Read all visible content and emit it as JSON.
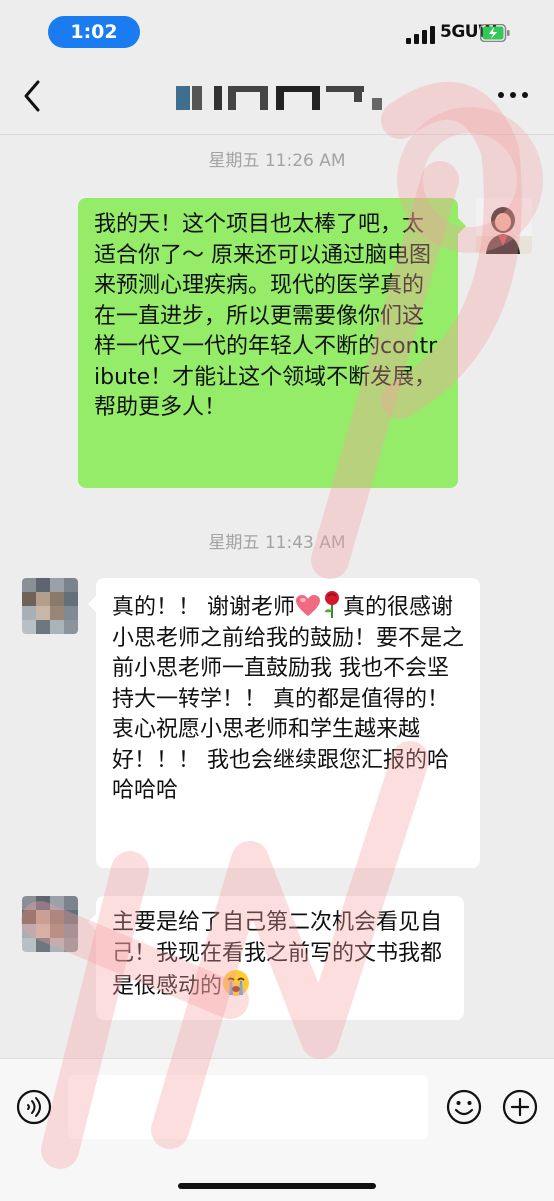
{
  "status_bar": {
    "time": "1:02",
    "network": "5GUW"
  },
  "nav": {
    "back_icon": "chevron-left-icon",
    "title": "",
    "more_icon": "more-dots-icon"
  },
  "messages": [
    {
      "type": "timestamp",
      "text": "星期五 11:26 AM"
    },
    {
      "type": "outgoing",
      "text": "我的天！这个项目也太棒了吧，太适合你了～ 原来还可以通过脑电图来预测心理疾病。现代的医学真的在一直进步，所以更需要像你们这样一代又一代的年轻人不断的contribute！才能让这个领域不断发展，帮助更多人！"
    },
    {
      "type": "timestamp",
      "text": "星期五 11:43 AM"
    },
    {
      "type": "incoming",
      "text_a": "真的！！ 谢谢老师",
      "emoji_1": "red-heart-emoji",
      "emoji_2": "rose-emoji",
      "text_b": "真的很感谢小思老师之前给我的鼓励！要不是之前小思老师一直鼓励我 我也不会坚持大一转学！！ 真的都是值得的！衷心祝愿小思老师和学生越来越好！！！ 我也会继续跟您汇报的哈哈哈哈"
    },
    {
      "type": "incoming",
      "text": "主要是给了自己第二次机会看见自己！我现在看我之前写的文书我都是很感动的",
      "emoji": "crying-emoji"
    }
  ],
  "input_bar": {
    "voice_icon": "voice-icon",
    "input_value": "",
    "emoji_icon": "smiley-icon",
    "plus_icon": "plus-icon"
  },
  "colors": {
    "outgoing_bubble": "#95ec69",
    "incoming_bubble": "#ffffff",
    "background": "#ededed",
    "time_pill": "#1a7cf0"
  }
}
